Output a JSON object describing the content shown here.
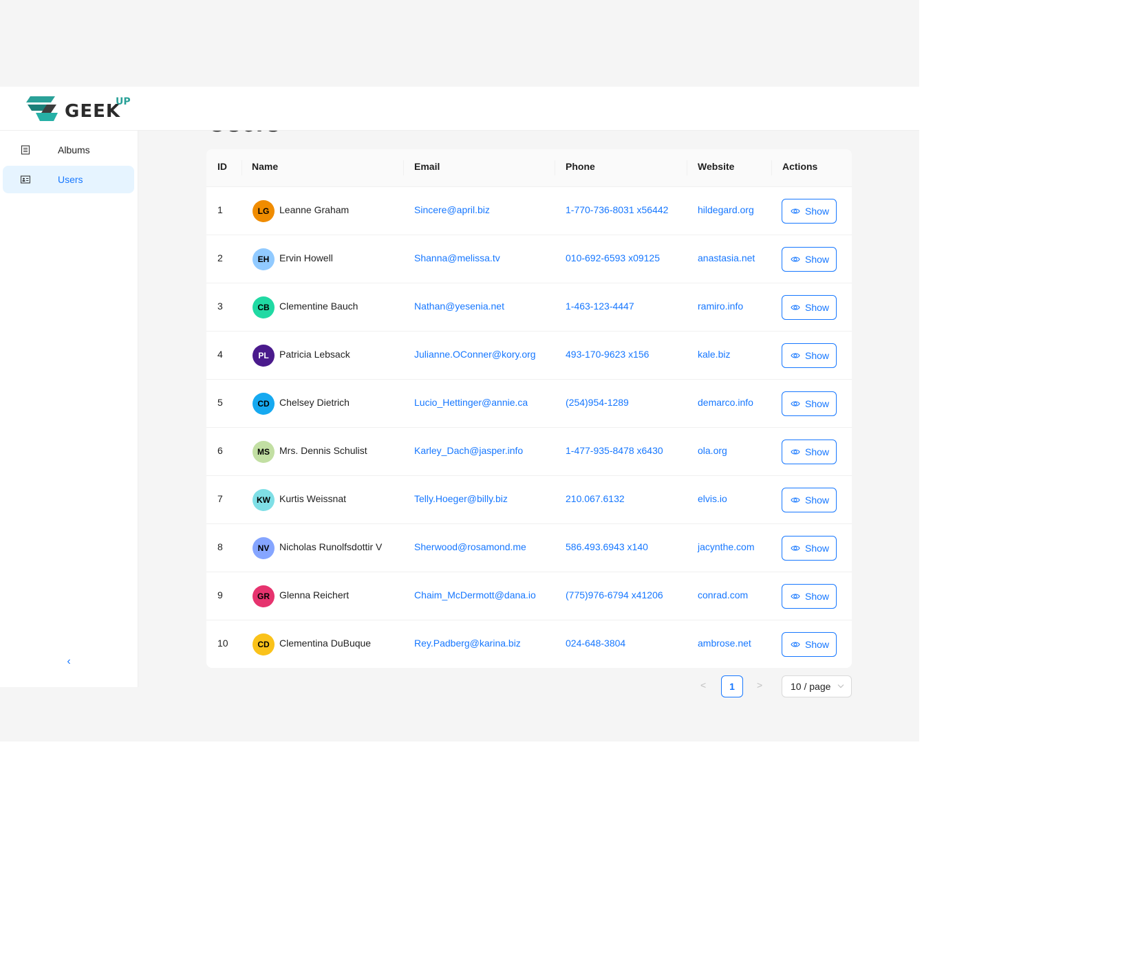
{
  "brand": {
    "name": "GEEK",
    "superscript": "UP"
  },
  "sidebar": {
    "items": [
      {
        "label": "Albums",
        "icon": "list-icon",
        "active": false
      },
      {
        "label": "Users",
        "icon": "id-card-icon",
        "active": true
      }
    ],
    "collapse_label": "‹"
  },
  "page": {
    "title": "Users"
  },
  "table": {
    "columns": [
      "ID",
      "Name",
      "Email",
      "Phone",
      "Website",
      "Actions"
    ],
    "rows": [
      {
        "id": "1",
        "initials": "LG",
        "avatar_color": "#f08c00",
        "name": "Leanne Graham",
        "email": "Sincere@april.biz",
        "phone": "1-770-736-8031 x56442",
        "website": "hildegard.org",
        "action": "Show"
      },
      {
        "id": "2",
        "initials": "EH",
        "avatar_color": "#91caff",
        "name": "Ervin Howell",
        "email": "Shanna@melissa.tv",
        "phone": "010-692-6593 x09125",
        "website": "anastasia.net",
        "action": "Show"
      },
      {
        "id": "3",
        "initials": "CB",
        "avatar_color": "#20d9a3",
        "name": "Clementine Bauch",
        "email": "Nathan@yesenia.net",
        "phone": "1-463-123-4447",
        "website": "ramiro.info",
        "action": "Show"
      },
      {
        "id": "4",
        "initials": "PL",
        "avatar_color": "#4a1a8c",
        "name": "Patricia Lebsack",
        "email": "Julianne.OConner@kory.org",
        "phone": "493-170-9623 x156",
        "website": "kale.biz",
        "action": "Show"
      },
      {
        "id": "5",
        "initials": "CD",
        "avatar_color": "#16a9f0",
        "name": "Chelsey Dietrich",
        "email": "Lucio_Hettinger@annie.ca",
        "phone": "(254)954-1289",
        "website": "demarco.info",
        "action": "Show"
      },
      {
        "id": "6",
        "initials": "MS",
        "avatar_color": "#c2dfa3",
        "name": "Mrs. Dennis Schulist",
        "email": "Karley_Dach@jasper.info",
        "phone": "1-477-935-8478 x6430",
        "website": "ola.org",
        "action": "Show"
      },
      {
        "id": "7",
        "initials": "KW",
        "avatar_color": "#7fdfe6",
        "name": "Kurtis Weissnat",
        "email": "Telly.Hoeger@billy.biz",
        "phone": "210.067.6132",
        "website": "elvis.io",
        "action": "Show"
      },
      {
        "id": "8",
        "initials": "NV",
        "avatar_color": "#85a5ff",
        "name": "Nicholas Runolfsdottir V",
        "email": "Sherwood@rosamond.me",
        "phone": "586.493.6943 x140",
        "website": "jacynthe.com",
        "action": "Show"
      },
      {
        "id": "9",
        "initials": "GR",
        "avatar_color": "#e6336e",
        "name": "Glenna Reichert",
        "email": "Chaim_McDermott@dana.io",
        "phone": "(775)976-6794 x41206",
        "website": "conrad.com",
        "action": "Show"
      },
      {
        "id": "10",
        "initials": "CD",
        "avatar_color": "#fac21a",
        "name": "Clementina DuBuque",
        "email": "Rey.Padberg@karina.biz",
        "phone": "024-648-3804",
        "website": "ambrose.net",
        "action": "Show"
      }
    ]
  },
  "pagination": {
    "prev": "<",
    "current": "1",
    "next": ">",
    "page_size": "10 / page"
  },
  "colors": {
    "accent": "#1677ff",
    "active_bg": "#e6f4ff",
    "brand": "#2aa198",
    "frame": "#f5f5f5"
  }
}
